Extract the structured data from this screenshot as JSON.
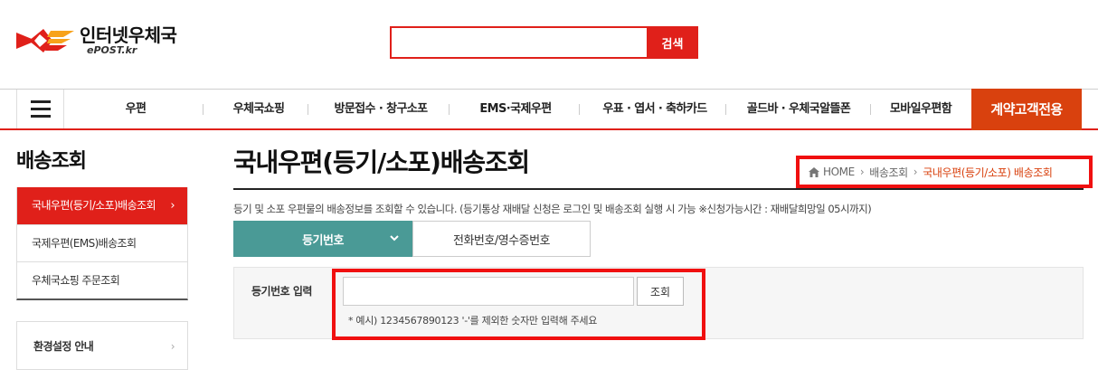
{
  "header": {
    "logo_title": "인터넷우체국",
    "logo_sub": "ePOST.kr",
    "search_value": "",
    "search_button": "검색"
  },
  "nav": {
    "items": [
      "우편",
      "우체국쇼핑",
      "방문접수 · 창구소포",
      "EMS·국제우편",
      "우표 · 엽서 · 축하카드",
      "골드바 · 우체국알뜰폰",
      "모바일우편함"
    ],
    "special": "계약고객전용",
    "colors": {
      "accent": "#e0201a",
      "special": "#d9410e"
    }
  },
  "sidebar": {
    "title": "배송조회",
    "items": [
      "국내우편(등기/소포)배송조회",
      "국제우편(EMS)배송조회",
      "우체국쇼핑 주문조회"
    ],
    "box": "환경설정 안내"
  },
  "main": {
    "title": "국내우편(등기/소포)배송조회",
    "breadcrumb": {
      "home": "HOME",
      "level1": "배송조회",
      "current": "국내우편(등기/소포) 배송조회"
    },
    "description": "등기 및 소포 우편물의 배송정보를 조회할 수 있습니다. (등기통상 재배달 신청은 로그인 및 배송조회 실행 시 가능 ※신청가능시간 : 재배달희망일 05시까지)",
    "tabs": [
      "등기번호",
      "전화번호/영수증번호"
    ],
    "tab_color": "#4a9a96",
    "form": {
      "label": "등기번호 입력",
      "input_value": "",
      "button": "조회",
      "hint": "* 예시) 1234567890123 '-'를 제외한 숫자만 입력해 주세요"
    }
  }
}
